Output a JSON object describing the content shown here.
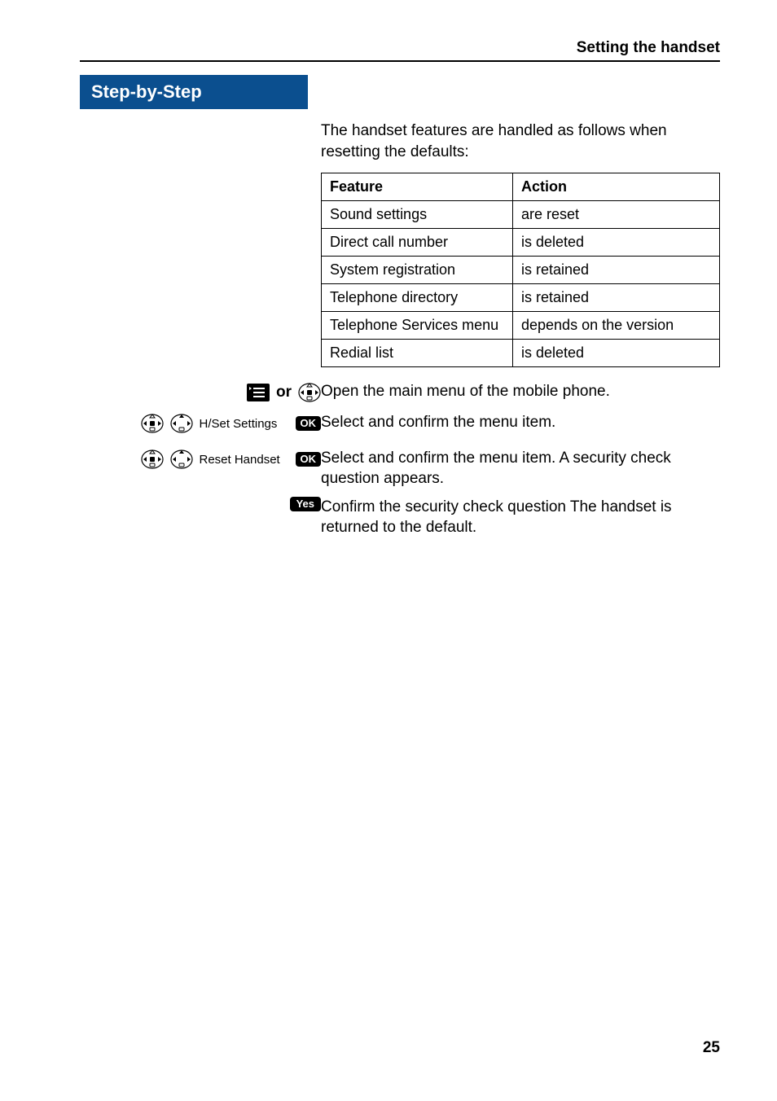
{
  "header": {
    "section": "Setting the handset"
  },
  "sbs": {
    "title": "Step-by-Step"
  },
  "intro": "The handset features are handled as follows when resetting the defaults:",
  "table": {
    "headers": {
      "feature": "Feature",
      "action": "Action"
    },
    "rows": [
      {
        "feature": "Sound settings",
        "action": "are reset"
      },
      {
        "feature": "Direct call number",
        "action": "is deleted"
      },
      {
        "feature": "System registration",
        "action": "is retained"
      },
      {
        "feature": "Telephone directory",
        "action": "is retained"
      },
      {
        "feature": "Telephone Services menu",
        "action": "depends on the version"
      },
      {
        "feature": "Redial list",
        "action": "is deleted"
      }
    ]
  },
  "steps": {
    "r1": {
      "or": "or",
      "desc": "Open the main menu of the mobile phone."
    },
    "r2": {
      "menu": "H/Set Settings",
      "ok": "OK",
      "desc": "Select and confirm the menu item."
    },
    "r3": {
      "menu": "Reset Handset",
      "ok": "OK",
      "desc": "Select and confirm the menu item. A security check question appears."
    },
    "r4": {
      "yes": "Yes",
      "desc": "Confirm the security check question The handset is returned to the default."
    }
  },
  "page_number": "25"
}
